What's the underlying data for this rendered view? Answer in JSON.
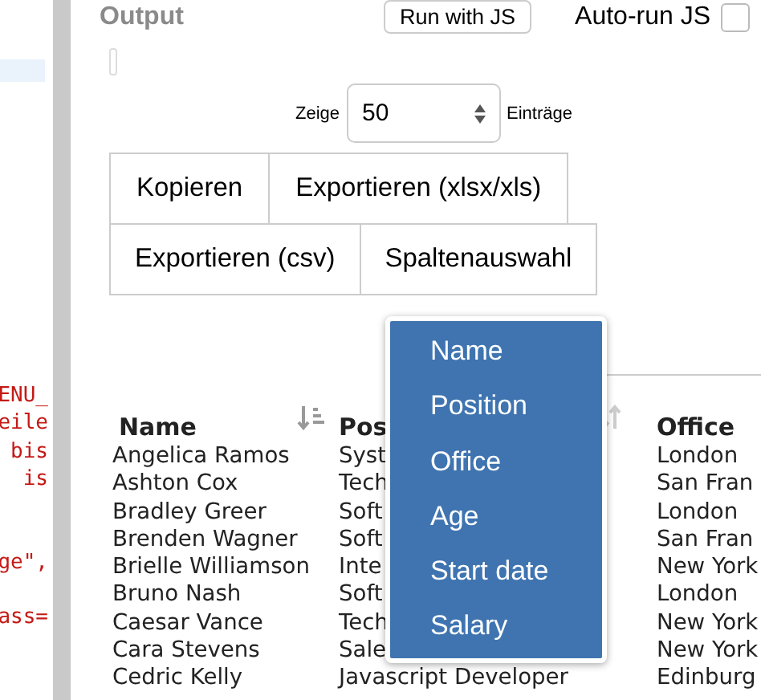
{
  "code_panel": {
    "lines": [
      {
        "kind": "code",
        "text": "ENU_"
      },
      {
        "kind": "code",
        "text": "eile"
      },
      {
        "kind": "code",
        "text": "bis"
      },
      {
        "kind": "code",
        "text": "is"
      },
      {
        "kind": "blank"
      },
      {
        "kind": "blank"
      },
      {
        "kind": "code",
        "text": "ge\","
      },
      {
        "kind": "blank"
      },
      {
        "kind": "code",
        "text": "ass="
      }
    ]
  },
  "output": {
    "title": "Output",
    "run_button": "Run with JS",
    "autorun": {
      "label": "Auto-run JS",
      "checked": false
    }
  },
  "length": {
    "prefix": "Zeige",
    "value": "50",
    "suffix": "Einträge"
  },
  "buttons": [
    [
      "Kopieren",
      "Exportieren (xlsx/xls)"
    ],
    [
      "Exportieren (csv)",
      "Spaltenauswahl"
    ]
  ],
  "column_menu": {
    "items": [
      {
        "label": "Name"
      },
      {
        "label": "Position"
      },
      {
        "label": "Office"
      },
      {
        "label": "Age"
      },
      {
        "label": "Start date"
      },
      {
        "label": "Salary"
      }
    ]
  },
  "table": {
    "columns": [
      {
        "label": "Name",
        "kind": "sorted"
      },
      {
        "label": "Pos",
        "kind": "sortable"
      },
      {
        "label": "Office",
        "kind": "plain"
      }
    ],
    "rows": [
      [
        "Angelica Ramos",
        "Syst",
        "London"
      ],
      [
        "Ashton Cox",
        "Tech",
        "San Fran"
      ],
      [
        "Bradley Greer",
        "Soft",
        "London"
      ],
      [
        "Brenden Wagner",
        "Soft",
        "San Fran"
      ],
      [
        "Brielle Williamson",
        "Inte",
        "New York"
      ],
      [
        "Bruno Nash",
        "Soft",
        "London"
      ],
      [
        "Caesar Vance",
        "Tech",
        "New York"
      ],
      [
        "Cara Stevens",
        "Sale",
        "New York"
      ],
      [
        "Cedric Kelly",
        "Javascript Developer",
        "Edinburg"
      ]
    ]
  }
}
